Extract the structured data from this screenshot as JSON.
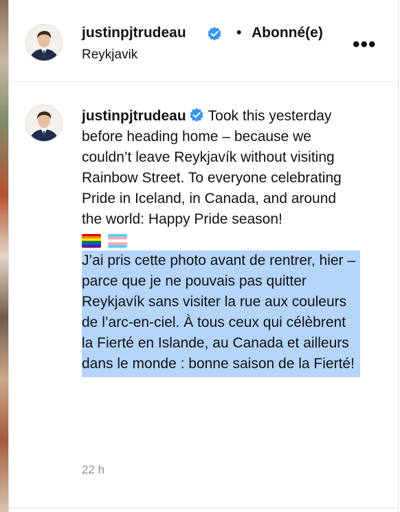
{
  "header": {
    "username": "justinpjtrudeau",
    "separator": "•",
    "follow_status": "Abonné(e)",
    "location": "Reykjavik",
    "more_icon": "more-horizontal-icon",
    "more_label": "•••"
  },
  "comment": {
    "username": "justinpjtrudeau",
    "text_en": "Took this yesterday before heading home – because we couldn’t leave Reykjavík without visiting Rainbow Street. To everyone celebrating Pride in Iceland, in Canada, and around the world: Happy Pride season!",
    "emojis": [
      "rainbow-flag-icon",
      "transgender-flag-icon"
    ],
    "text_fr": "J’ai pris cette photo avant de rentrer, hier – parce que je ne pouvais pas quitter Reykjavík sans visiter la rue aux couleurs de l’arc-en-ciel. À tous ceux qui célèbrent la Fierté en Islande, au Canada et ailleurs dans le monde : bonne saison de la Fierté!",
    "timestamp": "22 h"
  },
  "colors": {
    "verified_badge": "#3897f0",
    "selection_highlight": "#b5d5fb",
    "muted_text": "#8e8e8e"
  }
}
